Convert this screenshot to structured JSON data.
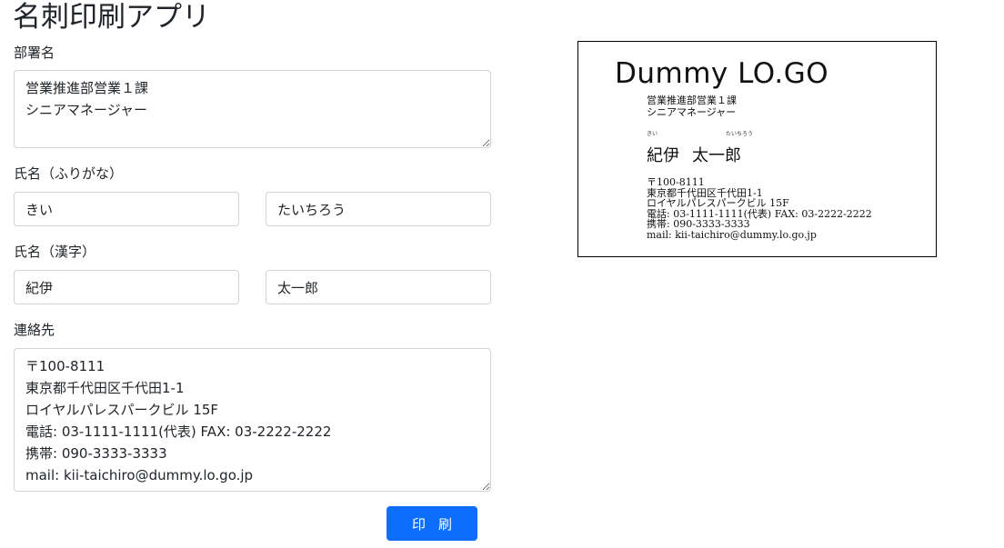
{
  "app": {
    "title": "名刺印刷アプリ"
  },
  "form": {
    "department": {
      "label": "部署名",
      "value": "営業推進部営業１課\nシニアマネージャー"
    },
    "furigana": {
      "label": "氏名（ふりがな）",
      "family": "きい",
      "given": "たいちろう"
    },
    "kanji": {
      "label": "氏名（漢字）",
      "family": "紀伊",
      "given": "太一郎"
    },
    "contact": {
      "label": "連絡先",
      "value": "〒100-8111\n東京都千代田区千代田1-1\nロイヤルパレスパークビル 15F\n電話: 03-1111-1111(代表) FAX: 03-2222-2222\n携帯: 090-3333-3333\nmail: kii-taichiro@dummy.lo.go.jp"
    },
    "print_button": "印刷"
  },
  "card": {
    "logo": "Dummy LO.GO",
    "department": "営業推進部営業１課\nシニアマネージャー",
    "kana_family": "きい",
    "kana_given": "たいちろう",
    "name_family": "紀伊",
    "name_given": "太一郎",
    "contact": "〒100-8111\n東京都千代田区千代田1-1\nロイヤルパレスパークビル 15F\n電話: 03-1111-1111(代表) FAX: 03-2222-2222\n携帯: 090-3333-3333\nmail: kii-taichiro@dummy.lo.go.jp"
  }
}
